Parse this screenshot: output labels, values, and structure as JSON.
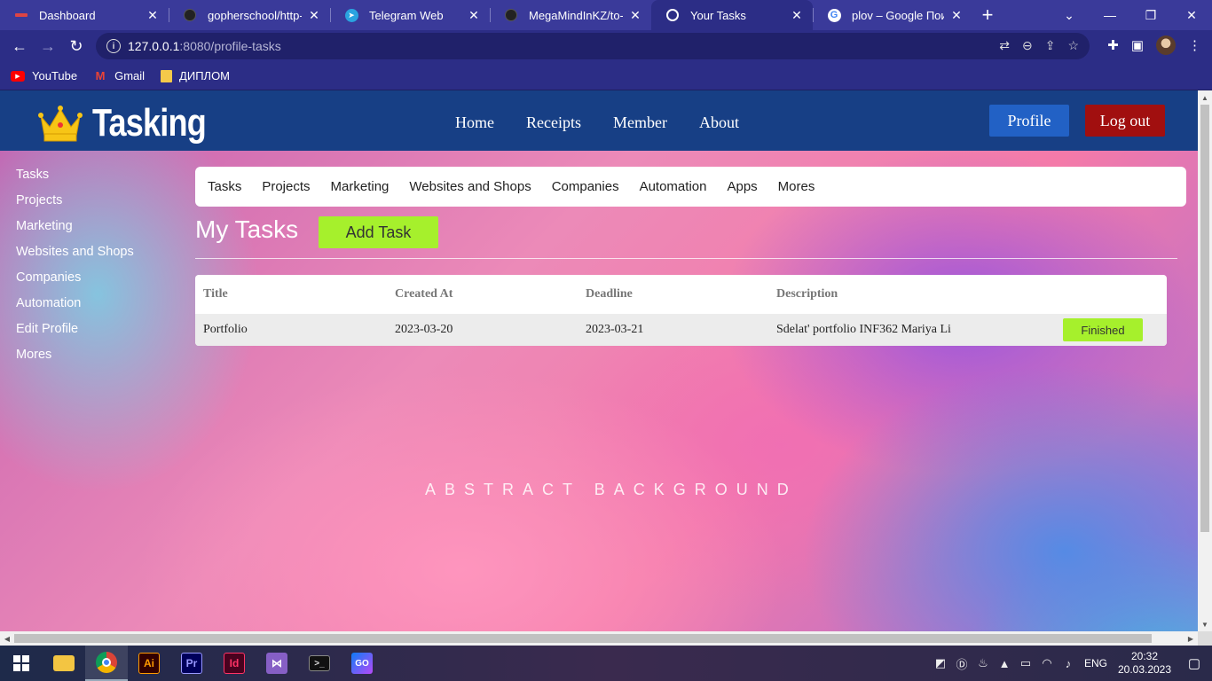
{
  "browser": {
    "tabs": [
      {
        "title": "Dashboard",
        "icon": "dashboard-favicon",
        "active": false
      },
      {
        "title": "gopherschool/http-re",
        "icon": "github-icon",
        "active": false
      },
      {
        "title": "Telegram Web",
        "icon": "telegram-icon",
        "active": false
      },
      {
        "title": "MegaMindInKZ/to-do",
        "icon": "github-icon",
        "active": false
      },
      {
        "title": "Your Tasks",
        "icon": "globe-icon",
        "active": true
      },
      {
        "title": "plov – Google Поиск",
        "icon": "google-icon",
        "active": false
      }
    ],
    "url_host": "127.0.0.1",
    "url_path": ":8080/profile-tasks",
    "bookmarks": [
      {
        "label": "YouTube",
        "icon": "youtube-icon"
      },
      {
        "label": "Gmail",
        "icon": "gmail-icon"
      },
      {
        "label": "ДИПЛОМ",
        "icon": "folder-icon"
      }
    ]
  },
  "site": {
    "brand": "Tasking",
    "nav": [
      "Home",
      "Receipts",
      "Member",
      "About"
    ],
    "profile_label": "Profile",
    "logout_label": "Log out"
  },
  "sidebar": {
    "items": [
      "Tasks",
      "Projects",
      "Marketing",
      "Websites and Shops",
      "Companies",
      "Automation",
      "Edit Profile",
      "Mores"
    ]
  },
  "categories": [
    "Tasks",
    "Projects",
    "Marketing",
    "Websites and Shops",
    "Companies",
    "Automation",
    "Apps",
    "Mores"
  ],
  "main": {
    "title": "My Tasks",
    "add_label": "Add Task"
  },
  "table": {
    "headers": [
      "Title",
      "Created At",
      "Deadline",
      "Description"
    ],
    "rows": [
      {
        "title": "Portfolio",
        "created_at": "2023-03-20",
        "deadline": "2023-03-21",
        "description": "Sdelat' portfolio INF362 Mariya Li",
        "status": "Finished"
      }
    ]
  },
  "background_caption": "ABSTRACT BACKGROUND",
  "taskbar": {
    "apps": [
      "windows-start-icon",
      "file-explorer-icon",
      "chrome-icon",
      "illustrator-icon",
      "premiere-icon",
      "indesign-icon",
      "visual-studio-icon",
      "terminal-icon",
      "goland-icon"
    ],
    "language": "ENG",
    "time": "20:32",
    "date": "20.03.2023"
  },
  "colors": {
    "header_bg": "#173f85",
    "profile_btn": "#2261c5",
    "logout_btn": "#a10f0f",
    "accent_green": "#a6f02c"
  }
}
